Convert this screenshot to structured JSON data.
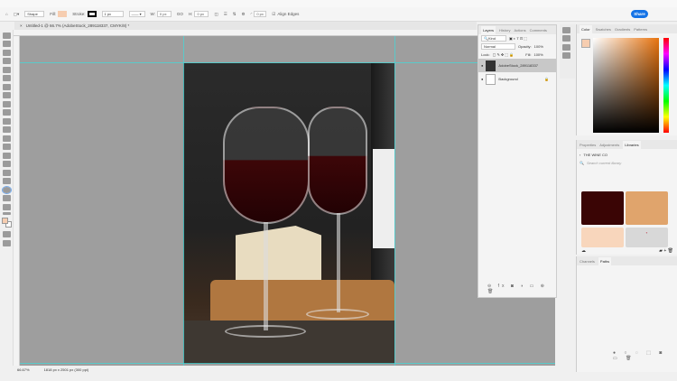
{
  "options": {
    "mode": "Shape",
    "fill_label": "Fill:",
    "stroke_label": "Stroke:",
    "stroke_width": "1 px",
    "w_label": "W:",
    "w_value": "0 px",
    "h_label": "H:",
    "h_value": "0 px",
    "radius": "0 px",
    "align_edges": "Align Edges",
    "fill_color": "#f6cdb0"
  },
  "share_label": "Share",
  "document_tab": "Untitled-1 @ 66.7% (AdobeStock_289118337, CMYK/8) *",
  "status": {
    "zoom": "66.67%",
    "size": "1818 px x 2501 px (300 ppi)"
  },
  "layers_panel": {
    "tabs": [
      "Layers",
      "History",
      "Actions",
      "Comments"
    ],
    "filter": "Kind",
    "blend": "Normal",
    "opacity_label": "Opacity:",
    "opacity": "100%",
    "lock_label": "Lock:",
    "fill_label": "Fill:",
    "fill": "100%",
    "layers": [
      {
        "name": "AdobeStock_289118337",
        "selected": true
      },
      {
        "name": "Background",
        "locked": true
      }
    ]
  },
  "color_panel": {
    "tabs": [
      "Color",
      "Swatches",
      "Gradients",
      "Patterns"
    ],
    "hue_color": "#e8740f"
  },
  "libraries_panel": {
    "tabs": [
      "Properties",
      "Adjustments",
      "Libraries"
    ],
    "library_name": "THE WINE CO",
    "search_placeholder": "Search current library",
    "swatches": [
      "#3a0505",
      "#e0a46c",
      "#f8d6bc",
      "#d8d8d8"
    ],
    "logo_text": "THE WINE CO"
  },
  "bottom_panel": {
    "tabs": [
      "Channels",
      "Paths"
    ]
  }
}
